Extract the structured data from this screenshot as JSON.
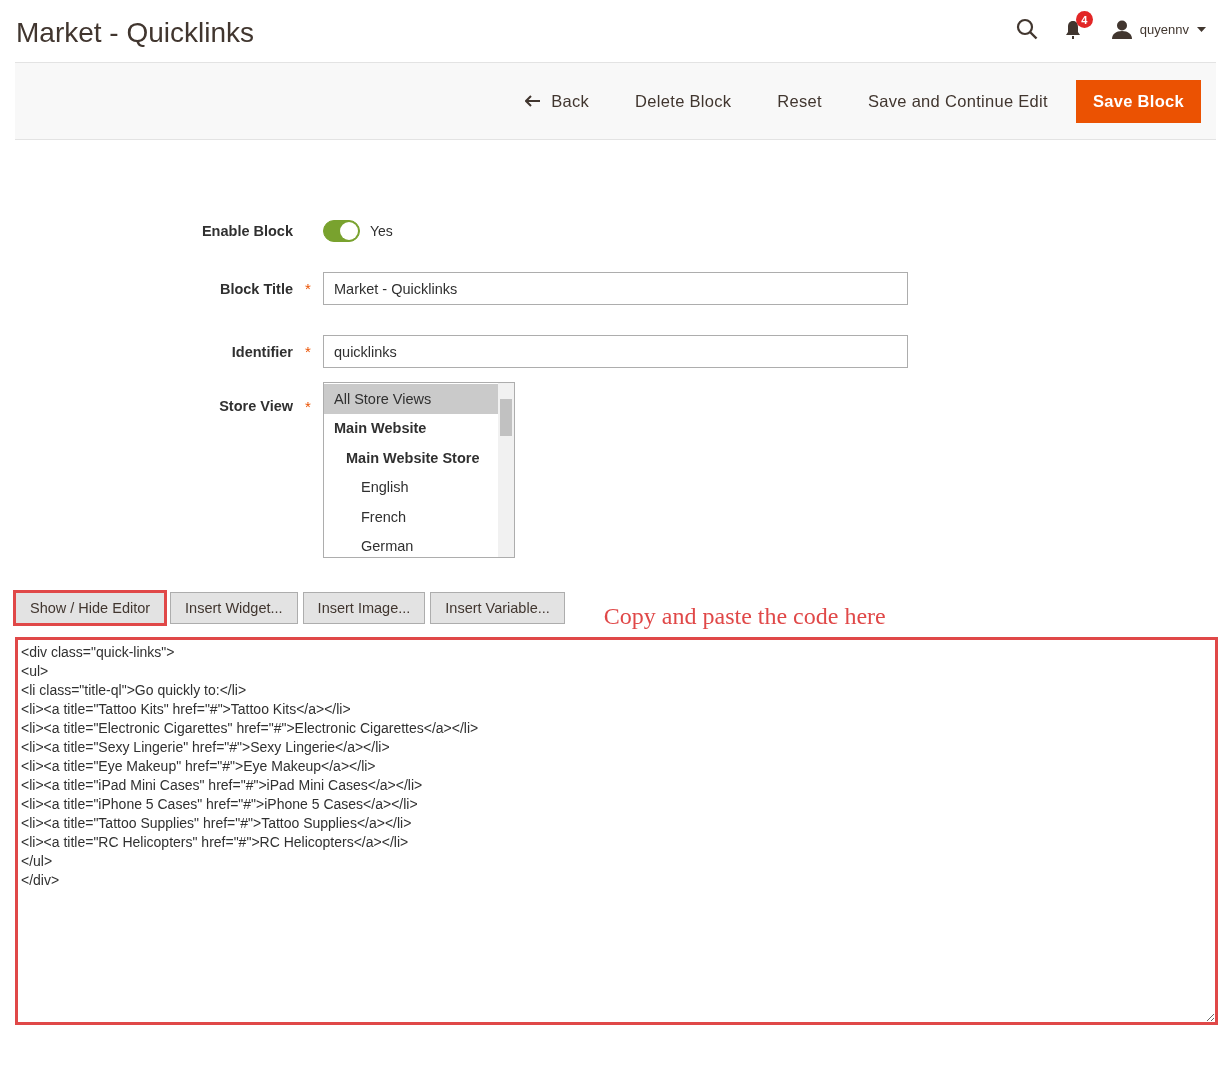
{
  "page_title": "Market - Quicklinks",
  "header": {
    "notifications_count": "4",
    "user": "quyennv"
  },
  "actions": [
    {
      "label": "Back",
      "kind": "back"
    },
    {
      "label": "Delete Block",
      "kind": "plain"
    },
    {
      "label": "Reset",
      "kind": "plain"
    },
    {
      "label": "Save and Continue Edit",
      "kind": "plain"
    },
    {
      "label": "Save Block",
      "kind": "primary"
    }
  ],
  "form": {
    "enable_block": {
      "label": "Enable Block",
      "on": true,
      "value_label": "Yes"
    },
    "block_title": {
      "label": "Block Title",
      "required_mark": "*",
      "value": "Market - Quicklinks"
    },
    "identifier": {
      "label": "Identifier",
      "required_mark": "*",
      "value": "quicklinks"
    },
    "store_view": {
      "label": "Store View",
      "required_mark": "*",
      "options": [
        {
          "label": "All Store Views",
          "selected": true,
          "kind": "option"
        },
        {
          "label": "Main Website",
          "selected": false,
          "kind": "group",
          "children": [
            {
              "label": "Main Website Store",
              "selected": false,
              "kind": "group",
              "children": [
                {
                  "label": "English",
                  "selected": false,
                  "kind": "option"
                },
                {
                  "label": "French",
                  "selected": false,
                  "kind": "option"
                },
                {
                  "label": "German",
                  "selected": false,
                  "kind": "option"
                }
              ]
            }
          ]
        }
      ]
    }
  },
  "editor_buttons": [
    {
      "label": "Show / Hide Editor",
      "highlighted": true
    },
    {
      "label": "Insert Widget...",
      "highlighted": false
    },
    {
      "label": "Insert Image...",
      "highlighted": false
    },
    {
      "label": "Insert Variable...",
      "highlighted": false
    }
  ],
  "annotation": "Copy and paste the code here",
  "content": {
    "highlighted": true,
    "lines": [
      "<div class=\"quick-links\">",
      "<ul>",
      "<li class=\"title-ql\">Go quickly to:</li>",
      "<li><a title=\"Tattoo Kits\" href=\"#\">Tattoo Kits</a></li>",
      "<li><a title=\"Electronic Cigarettes\" href=\"#\">Electronic Cigarettes</a></li>",
      "<li><a title=\"Sexy Lingerie\" href=\"#\">Sexy Lingerie</a></li>",
      "<li><a title=\"Eye Makeup\" href=\"#\">Eye Makeup</a></li>",
      "<li><a title=\"iPad Mini Cases\" href=\"#\">iPad Mini Cases</a></li>",
      "<li><a title=\"iPhone 5 Cases\" href=\"#\">iPhone 5 Cases</a></li>",
      "<li><a title=\"Tattoo Supplies\" href=\"#\">Tattoo Supplies</a></li>",
      "<li><a title=\"RC Helicopters\" href=\"#\">RC Helicopters</a></li>",
      "</ul>",
      "</div>"
    ]
  }
}
